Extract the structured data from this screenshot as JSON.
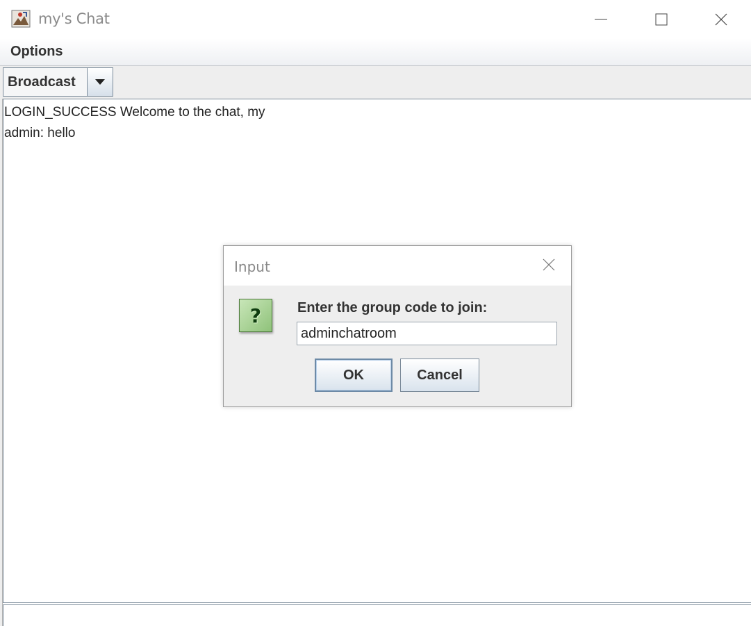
{
  "window": {
    "title": "my's Chat",
    "icons": [
      "app-java-icon",
      "minimize-icon",
      "maximize-icon",
      "close-icon"
    ]
  },
  "menubar": {
    "items": [
      {
        "label": "Options"
      }
    ]
  },
  "toolbar": {
    "combo": {
      "selected": "Broadcast",
      "icon": "dropdown-arrow-icon"
    }
  },
  "chat": {
    "messages": [
      "LOGIN_SUCCESS Welcome to the chat, my",
      "admin: hello"
    ]
  },
  "dialog": {
    "title": "Input",
    "icon": "question-icon",
    "icon_glyph": "?",
    "prompt": "Enter the group code to join:",
    "input_value": "adminchatroom",
    "ok_label": "OK",
    "cancel_label": "Cancel"
  },
  "colors": {
    "question_icon_bg": "#8fc27a",
    "button_border": "#7a8a99"
  }
}
